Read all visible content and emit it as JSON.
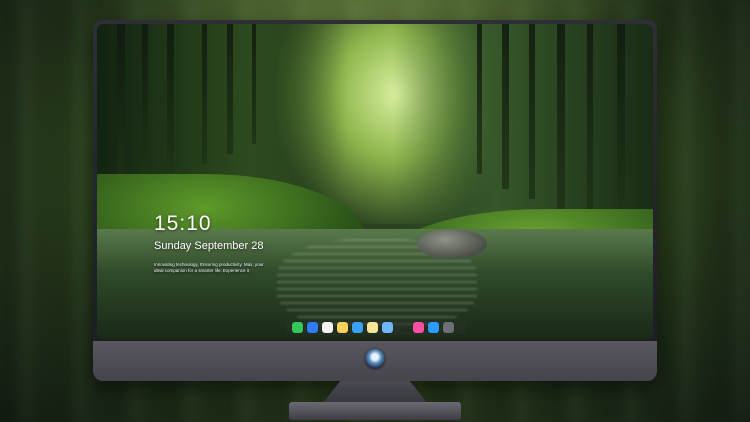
{
  "lockscreen": {
    "time": "15:10",
    "date": "Sunday September 28",
    "slogan": "Innovating technology, Ensuring productivity. Max, your ideal companion for a smarter life. Experience it"
  },
  "dock": {
    "items": [
      {
        "name": "messages-icon",
        "color": "#34c759"
      },
      {
        "name": "finder-icon",
        "color": "#2f7cf6"
      },
      {
        "name": "clock-icon",
        "color": "#f2f2f2"
      },
      {
        "name": "notes-icon",
        "color": "#f3d35a"
      },
      {
        "name": "clapper-icon",
        "color": "#3aa0f3"
      },
      {
        "name": "stickies-icon",
        "color": "#f7e59a"
      },
      {
        "name": "preview-icon",
        "color": "#6fb7ff"
      },
      {
        "name": "music-icon",
        "color": "#ff4fa3"
      },
      {
        "name": "app-store-icon",
        "color": "#2b9bff"
      },
      {
        "name": "camera-icon",
        "color": "#6d6f76"
      }
    ]
  },
  "colors": {
    "bezel": "#1f2025",
    "chin": "#504f57"
  }
}
